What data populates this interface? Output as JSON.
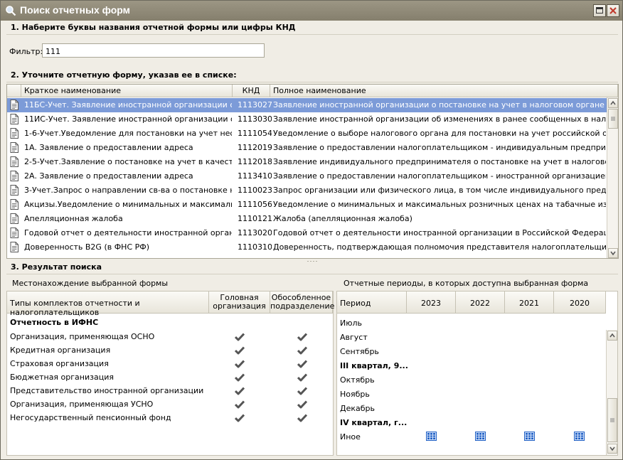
{
  "window": {
    "title": "Поиск отчетных форм"
  },
  "section1": {
    "heading": "1. Наберите буквы названия отчетной формы или цифры КНД",
    "filter_label": "Фильтр:",
    "filter_value": "111"
  },
  "section2": {
    "heading": "2. Уточните отчетную форму, указав ее в списке:",
    "columns": [
      "Краткое наименование",
      "КНД",
      "Полное наименование"
    ],
    "rows": [
      {
        "short": "11БС-Учет. Заявление иностранной организации о по...",
        "knd": "1113027",
        "full": "Заявление иностранной организации о постановке на учет в налоговом органе в связи с..."
      },
      {
        "short": "11ИС-Учет. Заявление иностранной организации об и...",
        "knd": "1113030",
        "full": "Заявление иностранной организации об изменениях в ранее сообщенных в налоговый о..."
      },
      {
        "short": "1-6-Учет.Уведомление для постановки на учет неско...",
        "knd": "1111054",
        "full": "Уведомление о выборе налогового органа для постановки на учет российской организа..."
      },
      {
        "short": "1А. Заявление о предоставлении адреса",
        "knd": "1112019",
        "full": "Заявление о предоставлении налогоплательщиком - индивидуальным предпринимателе..."
      },
      {
        "short": "2-5-Учет.Заявление о постановке на учет в качестве ...",
        "knd": "1112018",
        "full": "Заявление индивидуального предпринимателя о постановке на учет в налоговом орган..."
      },
      {
        "short": "2А. Заявление о предоставлении адреса",
        "knd": "1113410",
        "full": "Заявление о предоставлении налогоплательщиком - иностранной организацией, не осу..."
      },
      {
        "short": "3-Учет.Запрос о направлении св-ва о постановке на у...",
        "knd": "1110023",
        "full": "Запрос организации или физического лица, в том числе индивидуального предпринимат..."
      },
      {
        "short": "Акцизы.Уведомление о минимальных и максимальных ...",
        "knd": "1111056",
        "full": "Уведомление о минимальных и максимальных розничных ценах на табачные изделия, п..."
      },
      {
        "short": "Апелляционная жалоба",
        "knd": "1110121",
        "full": "Жалоба (апелляционная жалоба)"
      },
      {
        "short": "Годовой отчет о деятельности иностранной организа...",
        "knd": "1113020",
        "full": "Годовой отчет о деятельности иностранной организации в Российской Федерации"
      },
      {
        "short": "Доверенность B2G (в ФНС РФ)",
        "knd": "1110310",
        "full": "Доверенность, подтверждающая полномочия представителя налогоплательщика (пла..."
      }
    ]
  },
  "section3": {
    "heading": "3. Результат поиска",
    "location": {
      "title": "Местонахождение выбранной формы",
      "columns": [
        "Типы комплектов отчетности и налогоплательщиков",
        "Головная организация",
        "Обособленное подразделение"
      ],
      "group": "Отчетность в ИФНС",
      "rows": [
        {
          "label": "Организация, применяющая ОСНО",
          "head": true,
          "branch": true
        },
        {
          "label": "Кредитная организация",
          "head": true,
          "branch": true
        },
        {
          "label": "Страховая организация",
          "head": true,
          "branch": true
        },
        {
          "label": "Бюджетная организация",
          "head": true,
          "branch": true
        },
        {
          "label": "Представительство иностранной организации",
          "head": true,
          "branch": true
        },
        {
          "label": "Организация, применяющая УСНО",
          "head": true,
          "branch": true
        },
        {
          "label": "Негосударственный пенсионный фонд",
          "head": true,
          "branch": true
        }
      ]
    },
    "periods": {
      "title": "Отчетные периоды, в которых доступна выбранная форма",
      "columns": [
        "Период",
        "2023",
        "2022",
        "2021",
        "2020"
      ],
      "rows": [
        {
          "label": "Июль",
          "bold": false,
          "icons": false
        },
        {
          "label": "Август",
          "bold": false,
          "icons": false
        },
        {
          "label": "Сентябрь",
          "bold": false,
          "icons": false
        },
        {
          "label": "III квартал, 9...",
          "bold": true,
          "icons": false
        },
        {
          "label": "Октябрь",
          "bold": false,
          "icons": false
        },
        {
          "label": "Ноябрь",
          "bold": false,
          "icons": false
        },
        {
          "label": "Декабрь",
          "bold": false,
          "icons": false
        },
        {
          "label": "IV квартал, г...",
          "bold": true,
          "icons": false
        },
        {
          "label": "Иное",
          "bold": false,
          "icons": true
        }
      ]
    }
  },
  "colors": {
    "selection": "#7c9bd8",
    "titlebar": "#8f8976",
    "background": "#f0ede5",
    "period_icon": "#1f5fc4"
  }
}
